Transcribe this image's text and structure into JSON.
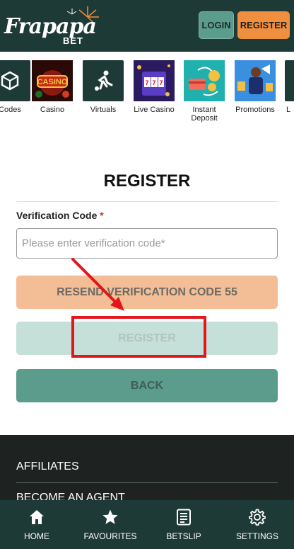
{
  "header": {
    "logo_main": "Frapapa",
    "logo_sub": "BET",
    "login_label": "LOGIN",
    "register_label": "REGISTER"
  },
  "categories": [
    {
      "label": "Codes",
      "icon": "codes-icon"
    },
    {
      "label": "Casino",
      "icon": "casino-icon"
    },
    {
      "label": "Virtuals",
      "icon": "virtuals-icon"
    },
    {
      "label": "Live Casino",
      "icon": "live-casino-icon"
    },
    {
      "label": "Instant Deposit",
      "icon": "instant-deposit-icon"
    },
    {
      "label": "Promotions",
      "icon": "promotions-icon"
    },
    {
      "label": "L",
      "icon": "more-icon"
    }
  ],
  "form": {
    "title": "REGISTER",
    "field_label": "Verification Code",
    "required_mark": "*",
    "input_value": "",
    "input_placeholder": "Please enter verification code*",
    "resend_label": "RESEND VERIFICATION CODE 55",
    "register_label": "REGISTER",
    "back_label": "BACK"
  },
  "footer": {
    "links": [
      "AFFILIATES",
      "BECOME AN AGENT"
    ]
  },
  "bottom_nav": [
    {
      "label": "HOME",
      "icon": "home-icon"
    },
    {
      "label": "FAVOURITES",
      "icon": "star-icon"
    },
    {
      "label": "BETSLIP",
      "icon": "betslip-icon"
    },
    {
      "label": "SETTINGS",
      "icon": "gear-icon"
    }
  ],
  "colors": {
    "header_bg": "#1e3a36",
    "accent_orange": "#f0903e",
    "accent_teal": "#5c9c8c",
    "annotation_red": "#e3161c"
  }
}
